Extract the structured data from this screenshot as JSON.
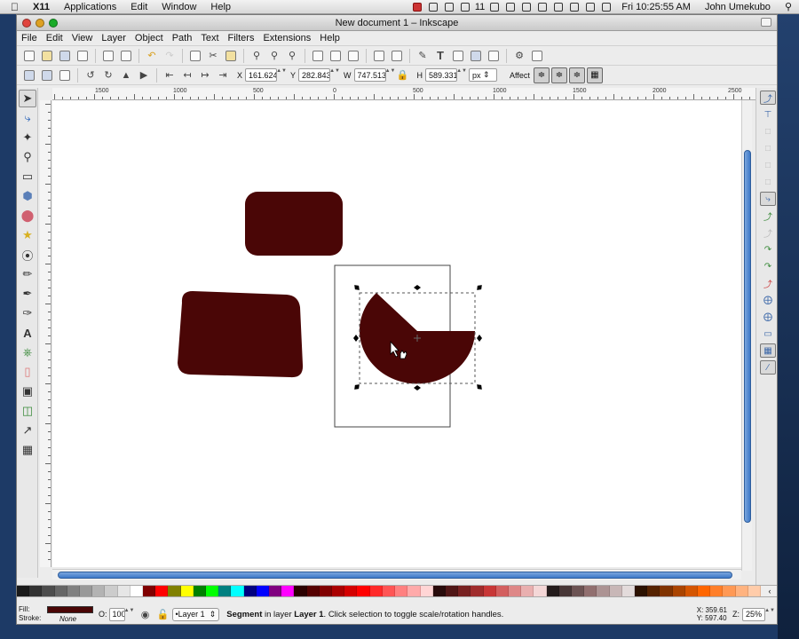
{
  "mac_menubar": {
    "apple": "",
    "app": "X11",
    "items": [
      "Applications",
      "Edit",
      "Window",
      "Help"
    ],
    "battery": "11",
    "clock": "Fri 10:25:55 AM",
    "user": "John Umekubo"
  },
  "window": {
    "title": "New document 1 – Inkscape"
  },
  "menu": [
    "File",
    "Edit",
    "View",
    "Layer",
    "Object",
    "Path",
    "Text",
    "Filters",
    "Extensions",
    "Help"
  ],
  "toolbar2": {
    "x_label": "X",
    "x_value": "161.624",
    "y_label": "Y",
    "y_value": "282.843",
    "w_label": "W",
    "w_value": "747.513",
    "h_label": "H",
    "h_value": "589.331",
    "unit": "px",
    "affect_label": "Affect"
  },
  "rulers": {
    "h_labels": [
      "1500",
      "1000",
      "500",
      "0",
      "500",
      "1000",
      "1500",
      "2000",
      "2500"
    ],
    "v_labels": []
  },
  "statusbar": {
    "fill_label": "Fill:",
    "stroke_label": "Stroke:",
    "stroke_value": "None",
    "opacity_label": "O:",
    "opacity_value": "100",
    "layer": "•Layer 1",
    "message_obj": "Segment",
    "message_mid": " in layer ",
    "message_layer": "Layer 1",
    "message_end": ". Click selection to toggle scale/rotation handles.",
    "x_label": "X:",
    "x_value": "359.61",
    "y_label": "Y:",
    "y_value": "597.40",
    "zoom_label": "Z:",
    "zoom_value": "25%"
  },
  "colors": {
    "shape_fill": "#4a0606",
    "accent_blue": "#3d78c8"
  },
  "palette": [
    "#1a1a1a",
    "#333333",
    "#4d4d4d",
    "#666666",
    "#808080",
    "#999999",
    "#b3b3b3",
    "#cccccc",
    "#e6e6e6",
    "#ffffff",
    "#800000",
    "#ff0000",
    "#808000",
    "#ffff00",
    "#008000",
    "#00ff00",
    "#008080",
    "#00ffff",
    "#000080",
    "#0000ff",
    "#800080",
    "#ff00ff",
    "#2b0000",
    "#550000",
    "#800000",
    "#aa0000",
    "#d40000",
    "#ff0000",
    "#ff2a2a",
    "#ff5555",
    "#ff8080",
    "#ffaaaa",
    "#ffd5d5",
    "#280b0b",
    "#501616",
    "#782121",
    "#a02c2c",
    "#c83737",
    "#d35f5f",
    "#de8787",
    "#e9afaf",
    "#f4d7d7",
    "#241c1c",
    "#483737",
    "#6c5353",
    "#916f6f",
    "#ac9393",
    "#c8b7b7",
    "#e3dbdb",
    "#2b1100",
    "#552200",
    "#803300",
    "#aa4400",
    "#d45500",
    "#ff6600",
    "#ff7f2a",
    "#ff9955",
    "#ffb380",
    "#ffccaa"
  ]
}
